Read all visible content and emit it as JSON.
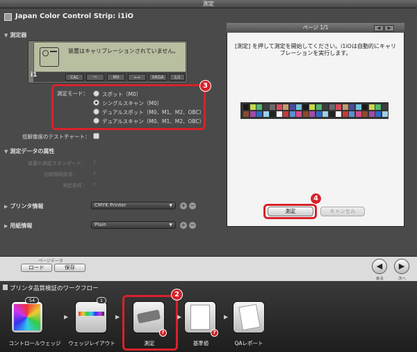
{
  "window": {
    "title": "測定"
  },
  "app": {
    "title": "Japan Color Control Strip: i1iO"
  },
  "device_section": {
    "title": "測定器"
  },
  "device": {
    "lcd_message": "装置はキャリブレーションされていません。",
    "logo": "i1",
    "keys": [
      "CAL",
      "〜",
      "M0",
      "⟷",
      "XRGA",
      "1/1"
    ]
  },
  "measurement_mode": {
    "label": "測定モード：",
    "options": [
      "スポット（M0）",
      "シングルスキャン（M0）",
      "デュアルスポット（M0、M1、M2、OBC）",
      "デュアルスキャン（M0、M1、M2、OBC）"
    ],
    "selected_index": 1
  },
  "low_res_chart": {
    "label": "低解像度のテストチャート："
  },
  "attributes": {
    "title": "測定データの属性",
    "rows": [
      "装置の測定スタンダード：",
      "比較照明条件：",
      "測定条件："
    ],
    "value": "?"
  },
  "printer": {
    "label": "プリンタ情報",
    "value": "CMYK Printer"
  },
  "paper": {
    "label": "用紙情報",
    "value": "Plain"
  },
  "right_panel": {
    "page": "ページ 1/1",
    "instruction": "[測定] を押して測定を開始してください。i1iOは自動的にキャリブレーションを実行します。",
    "measure_button": "測定",
    "cancel_button": "キャンセル"
  },
  "callouts": {
    "c2": "2",
    "c3": "3",
    "c4": "4"
  },
  "nav": {
    "page_data": "ページデータ",
    "load": "ロード",
    "save": "保存",
    "back": "戻る",
    "next": "次へ"
  },
  "workflow": {
    "title": "プリンタ品質検証のワークフロー",
    "steps": [
      {
        "label": "コントロールウェッジ",
        "count": "54"
      },
      {
        "label": "ウェッジレイアウト",
        "count": "1"
      },
      {
        "label": "測定",
        "count": ""
      },
      {
        "label": "基準値",
        "count": ""
      },
      {
        "label": "QAレポート",
        "count": ""
      }
    ]
  },
  "strip_colors": [
    "#1a1a1a",
    "#5b8fd6",
    "#2fb4e8",
    "#c8d84a",
    "#d94a8c",
    "#e8e03a",
    "#4fb870",
    "#8d4a2a",
    "#ece6d0",
    "#3d3d3d",
    "#a24aa8",
    "#e85a3a",
    "#6a6a6a",
    "#2a6ac8",
    "#f0e4b0",
    "#d64a5a",
    "#9ad0e8",
    "#3a9a4a",
    "#c49a6a",
    "#222",
    "#e8b0c8",
    "#4a4aa0",
    "#f4f4f4",
    "#b0b0b0",
    "#70c0d8",
    "#c83a3a",
    "#8a8a8a"
  ]
}
